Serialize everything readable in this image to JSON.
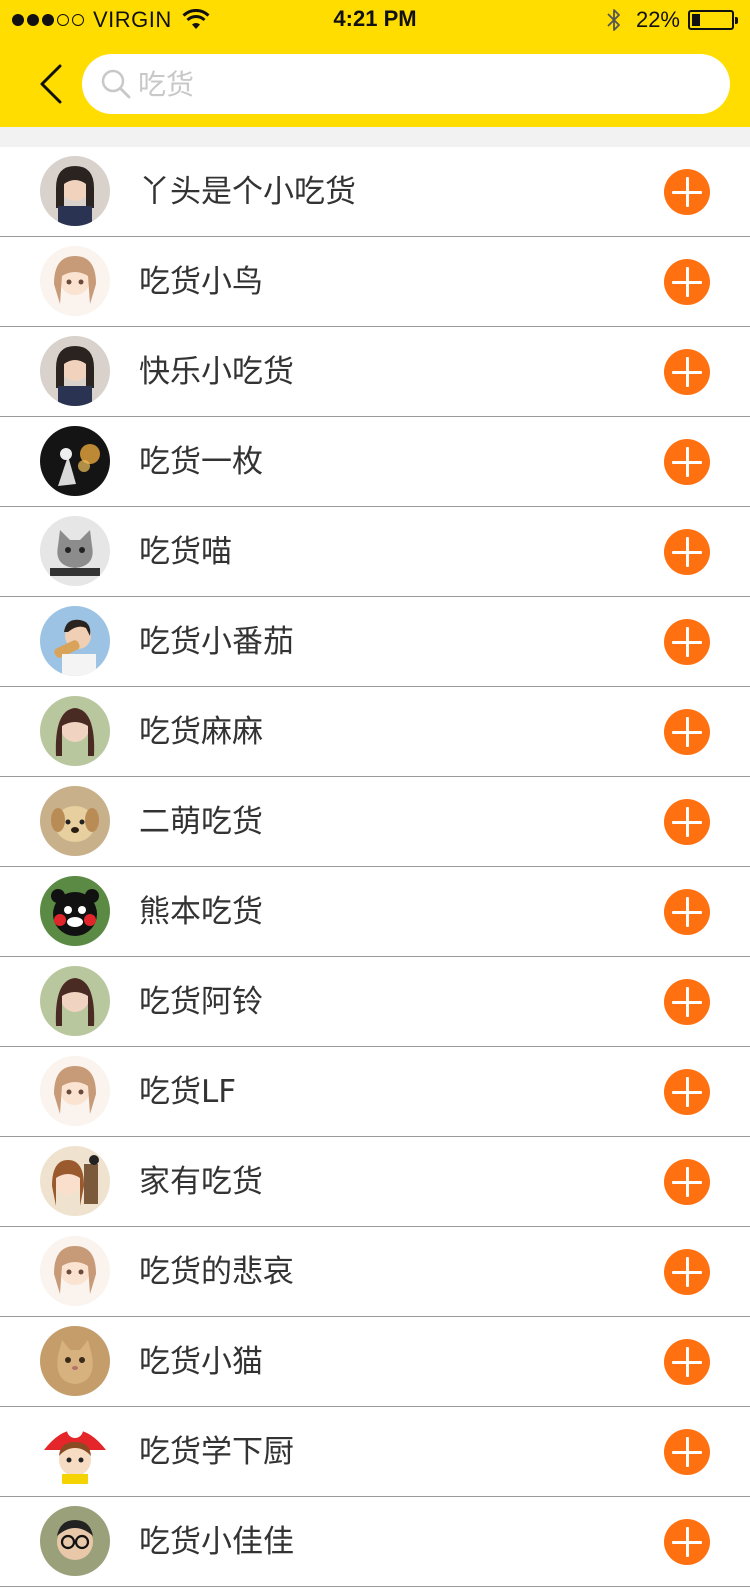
{
  "status_bar": {
    "signal_bars_filled": 3,
    "signal_bars_total": 5,
    "carrier": "VIRGIN",
    "time": "4:21 PM",
    "battery_percent": "22%",
    "battery_level": 0.22
  },
  "search": {
    "placeholder": "吃货",
    "value": ""
  },
  "colors": {
    "header_bg": "#ffdd00",
    "add_button": "#ff7011",
    "text": "#333333",
    "placeholder": "#c8c8c8"
  },
  "results": [
    {
      "name": "丫头是个小吃货",
      "avatar": "girl-photo"
    },
    {
      "name": "吃货小鸟",
      "avatar": "anime-girl"
    },
    {
      "name": "快乐小吃货",
      "avatar": "girl-photo"
    },
    {
      "name": "吃货一枚",
      "avatar": "dark-illustration"
    },
    {
      "name": "吃货喵",
      "avatar": "cat-grayscale"
    },
    {
      "name": "吃货小番茄",
      "avatar": "girl-eating"
    },
    {
      "name": "吃货麻麻",
      "avatar": "woman-photo"
    },
    {
      "name": "二萌吃货",
      "avatar": "puppy"
    },
    {
      "name": "熊本吃货",
      "avatar": "kumamon-bear"
    },
    {
      "name": "吃货阿铃",
      "avatar": "woman-photo"
    },
    {
      "name": "吃货LF",
      "avatar": "anime-girl"
    },
    {
      "name": "家有吃货",
      "avatar": "anime-illustration"
    },
    {
      "name": "吃货的悲哀",
      "avatar": "anime-girl"
    },
    {
      "name": "吃货小猫",
      "avatar": "kitten"
    },
    {
      "name": "吃货学下厨",
      "avatar": "cartoon-boy"
    },
    {
      "name": "吃货小佳佳",
      "avatar": "man-glasses"
    }
  ]
}
